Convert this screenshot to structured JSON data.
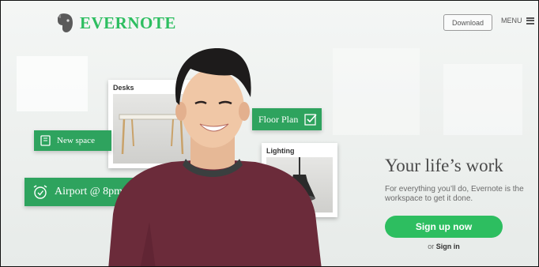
{
  "header": {
    "logo_text": "EVERNOTE",
    "download_label": "Download",
    "menu_label": "MENU"
  },
  "cards": {
    "desks_title": "Desks",
    "lighting_title": "Lighting"
  },
  "pills": {
    "new_space": "New space",
    "floor_plan": "Floor Plan",
    "airport": "Airport @ 8pm"
  },
  "hero": {
    "headline": "Your life’s work",
    "subtext": "For everything you’ll do, Evernote is the workspace to get it done.",
    "signup_label": "Sign up now",
    "signin_prefix": "or",
    "signin_label": "Sign in"
  },
  "colors": {
    "brand_green": "#2dbe60",
    "pill_green": "#2ea35e",
    "sweater": "#6b2b3a"
  }
}
